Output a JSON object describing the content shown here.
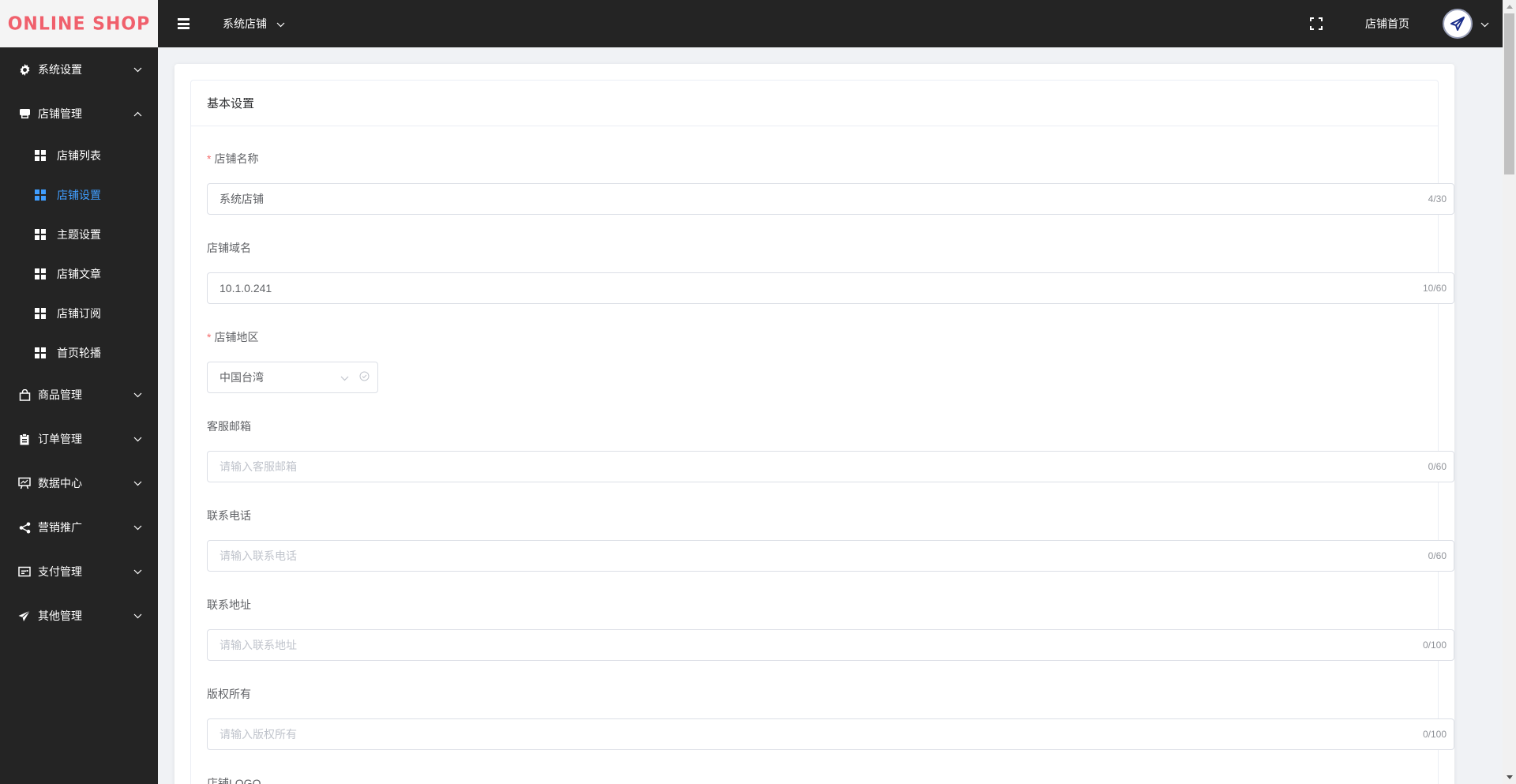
{
  "logo": "ONLINE SHOP",
  "topbar": {
    "shop_selector": "系统店铺",
    "home_link": "店铺首页"
  },
  "sidebar": {
    "menus": [
      {
        "label": "系统设置",
        "icon": "gear-icon",
        "expanded": false
      },
      {
        "label": "店铺管理",
        "icon": "store-icon",
        "expanded": true,
        "children": [
          {
            "label": "店铺列表",
            "active": false
          },
          {
            "label": "店铺设置",
            "active": true
          },
          {
            "label": "主题设置",
            "active": false
          },
          {
            "label": "店铺文章",
            "active": false
          },
          {
            "label": "店铺订阅",
            "active": false
          },
          {
            "label": "首页轮播",
            "active": false
          }
        ]
      },
      {
        "label": "商品管理",
        "icon": "shopping-bag-icon",
        "expanded": false
      },
      {
        "label": "订单管理",
        "icon": "clipboard-icon",
        "expanded": false
      },
      {
        "label": "数据中心",
        "icon": "presentation-chart-icon",
        "expanded": false
      },
      {
        "label": "营销推广",
        "icon": "share-icon",
        "expanded": false
      },
      {
        "label": "支付管理",
        "icon": "payment-card-icon",
        "expanded": false
      },
      {
        "label": "其他管理",
        "icon": "paper-plane-icon",
        "expanded": false
      }
    ]
  },
  "main": {
    "section_title": "基本设置",
    "fields": {
      "store_name": {
        "label": "店铺名称",
        "required": true,
        "value": "系统店铺",
        "count": "4/30"
      },
      "store_domain": {
        "label": "店铺域名",
        "required": false,
        "value": "10.1.0.241",
        "count": "10/60"
      },
      "store_region": {
        "label": "店铺地区",
        "required": true,
        "value": "中国台湾"
      },
      "service_email": {
        "label": "客服邮箱",
        "required": false,
        "placeholder": "请输入客服邮箱",
        "count": "0/60"
      },
      "contact_phone": {
        "label": "联系电话",
        "required": false,
        "placeholder": "请输入联系电话",
        "count": "0/60"
      },
      "contact_address": {
        "label": "联系地址",
        "required": false,
        "placeholder": "请输入联系地址",
        "count": "0/100"
      },
      "copyright": {
        "label": "版权所有",
        "required": false,
        "placeholder": "请输入版权所有",
        "count": "0/100"
      },
      "store_logo": {
        "label": "店铺LOGO"
      }
    },
    "required_mark": "*"
  },
  "colors": {
    "sidebar_bg": "#242424",
    "topbar_bg": "#242424",
    "active": "#409eff",
    "logo": "#f0606c",
    "required": "#f56c6c"
  },
  "scroll": {
    "visible_fraction": 0.2
  }
}
